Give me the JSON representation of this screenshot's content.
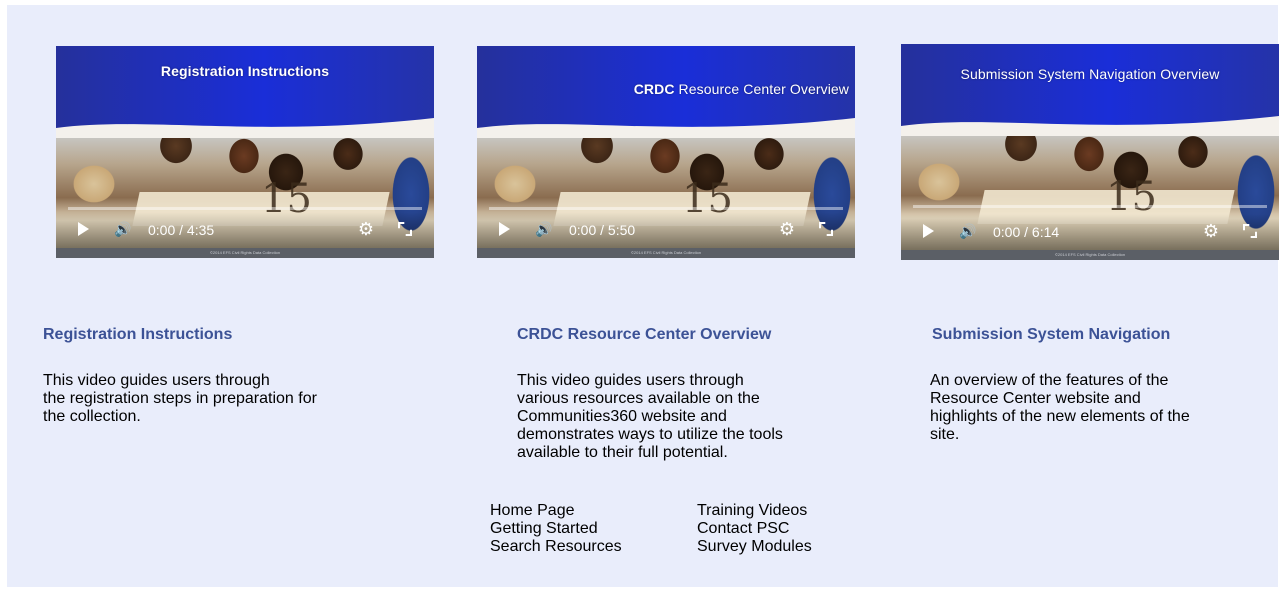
{
  "videos": [
    {
      "overlay_title": "Registration Instructions",
      "time": "0:00 / 4:35",
      "scene_number": "15",
      "caption": "©2014 EFS Civil Rights Data Collection"
    },
    {
      "overlay_title_bold": "CRDC",
      "overlay_title_rest": " Resource Center Overview",
      "time": "0:00 / 5:50",
      "scene_number": "15",
      "caption": "©2014 EFS Civil Rights Data Collection"
    },
    {
      "overlay_title": "Submission System Navigation Overview",
      "time": "0:00 / 6:14",
      "scene_number": "15",
      "caption": "©2014 EFS Civil Rights Data Collection"
    }
  ],
  "cards": [
    {
      "title": "Registration Instructions",
      "description": "This video guides users through\nthe registration steps in preparation for\nthe collection."
    },
    {
      "title": "CRDC Resource Center Overview",
      "description": "This video guides users through\nvarious resources available on the\nCommunities360 website and\ndemonstrates ways to utilize the tools\navailable to their full potential."
    },
    {
      "title": "Submission System Navigation",
      "description": "An overview of the features of the\nResource Center website and\nhighlights of the new elements of the\nsite."
    }
  ],
  "nav_links": {
    "home": "Home Page",
    "training": "Training Videos",
    "getting_started": "Getting Started",
    "contact": "Contact PSC",
    "search": "Search Resources",
    "modules": "Survey Modules"
  },
  "colors": {
    "panel_bg": "#e9edfb",
    "card_title": "#3c5296",
    "banner_blue": "#1a2ed8"
  }
}
